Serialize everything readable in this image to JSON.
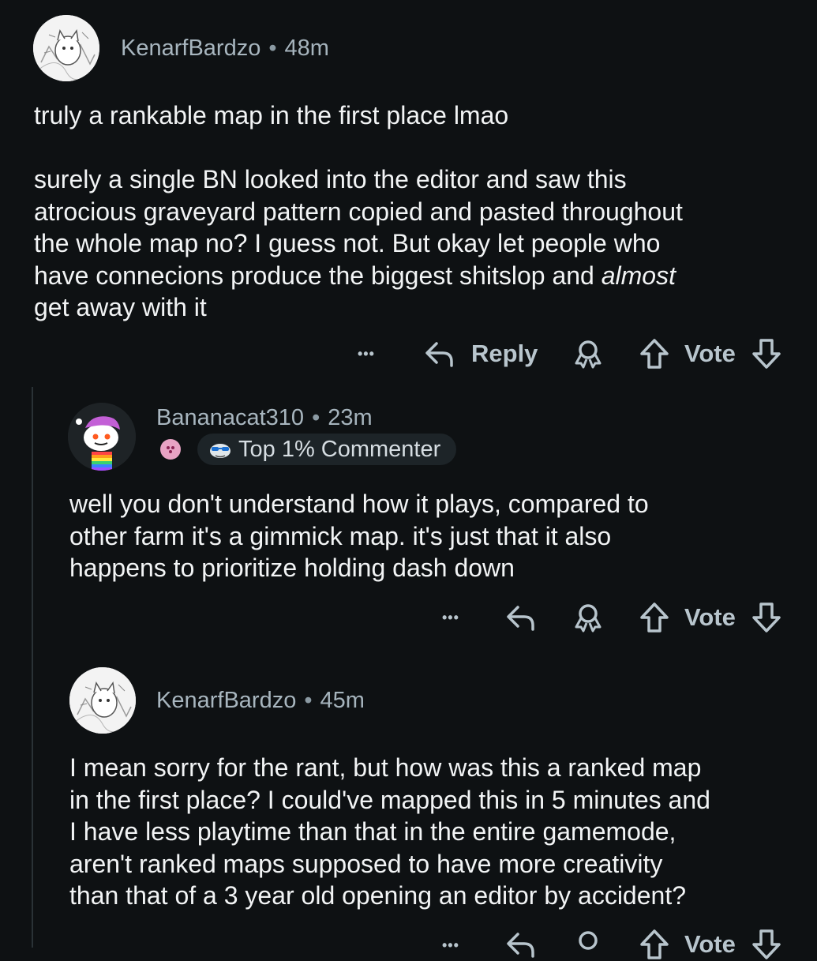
{
  "comments": [
    {
      "username": "KenarfBardzo",
      "separator": "•",
      "time": "48m",
      "avatar_icon": "cat-illustration-avatar",
      "body_lines": [
        "truly a rankable map in the first place lmao",
        "",
        "surely a single BN looked into the editor and saw this",
        "atrocious graveyard pattern copied and pasted throughout",
        "the whole map no? I guess not. But okay let people who",
        "have connecions produce the biggest shitslop and",
        "almost",
        "get away with it"
      ],
      "actions": {
        "more": "•••",
        "reply": "Reply",
        "vote": "Vote"
      }
    },
    {
      "username": "Bananacat310",
      "separator": "•",
      "time": "23m",
      "avatar_icon": "snoo-avatar",
      "badge": "Top 1% Commenter",
      "body_lines": [
        "well you don't understand how it plays, compared to",
        "other farm it's a gimmick map. it's just that it also",
        "happens to prioritize holding dash down"
      ],
      "actions": {
        "more": "•••",
        "vote": "Vote"
      }
    },
    {
      "username": "KenarfBardzo",
      "separator": "•",
      "time": "45m",
      "avatar_icon": "cat-illustration-avatar",
      "body_lines": [
        "I mean sorry for the rant, but how was this a ranked map",
        "in the first place? I could've mapped this in 5 minutes and",
        "I have less playtime than that in the entire gamemode,",
        "aren't ranked maps supposed to have more creativity",
        "than that of a 3 year old opening an editor by accident?"
      ],
      "actions": {
        "more": "•••",
        "vote": "Vote"
      }
    }
  ],
  "colors": {
    "background": "#0e1113",
    "text": "#f2f4f5",
    "meta": "#a5b3bc",
    "action": "#b8c5cd"
  }
}
